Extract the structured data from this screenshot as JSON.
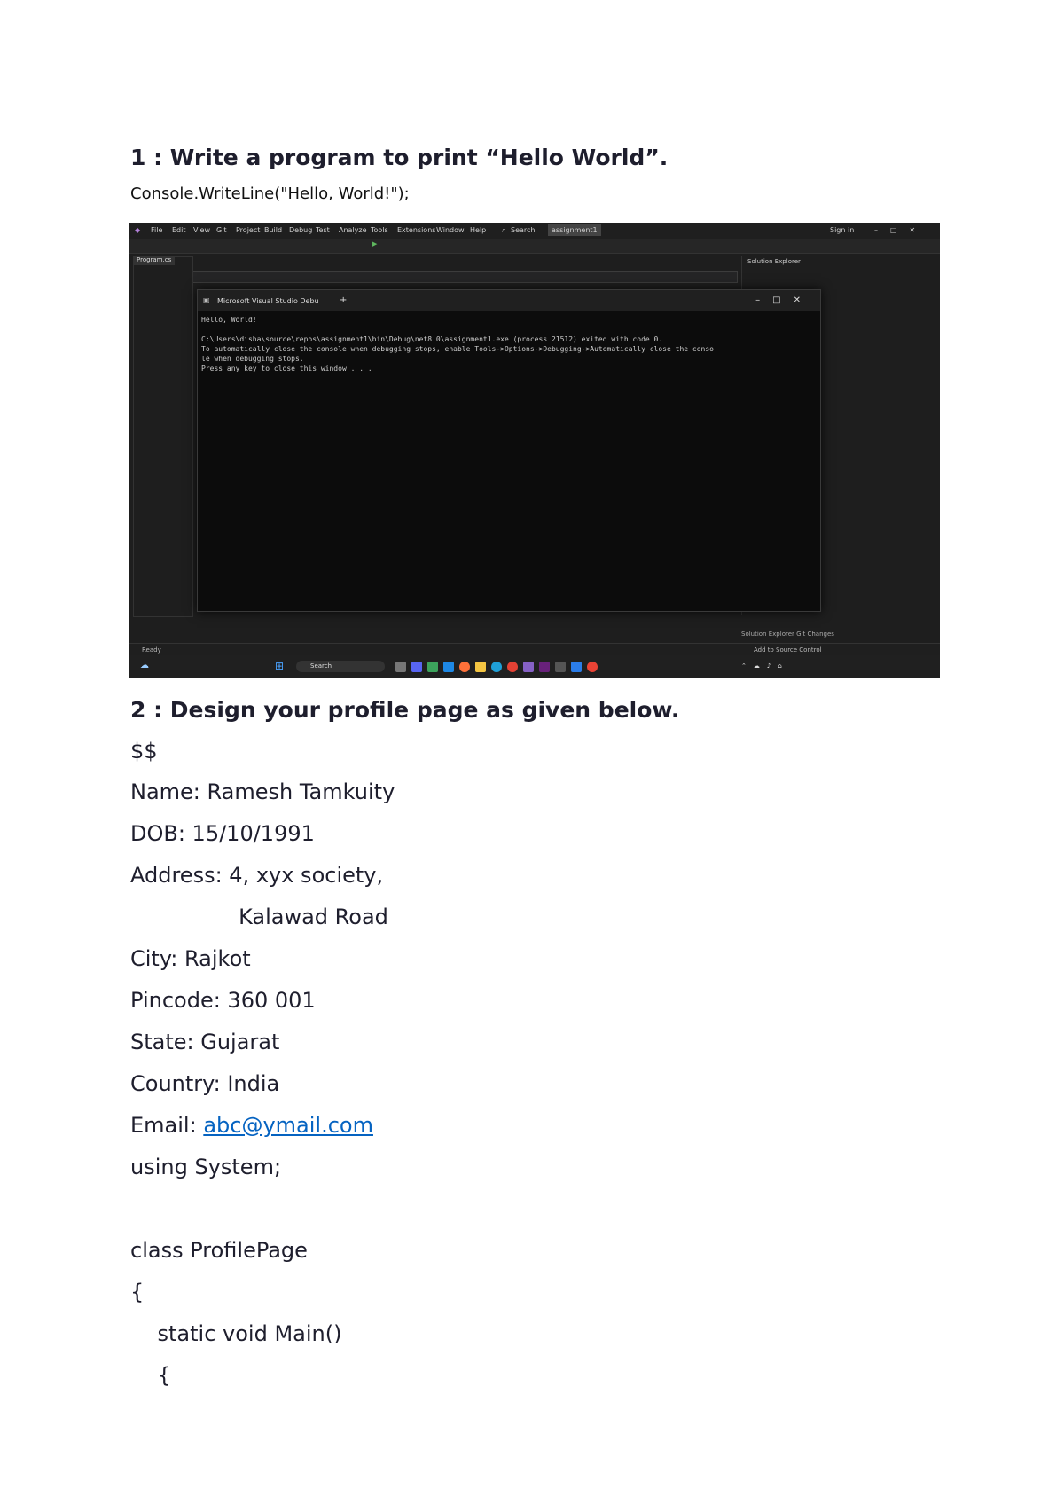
{
  "q1": {
    "heading": "1 : Write a program to print “Hello World”.",
    "code": "Console.WriteLine(\"Hello, World!\");"
  },
  "screenshot": {
    "menu": [
      "File",
      "Edit",
      "View",
      "Git",
      "Project",
      "Build",
      "Debug",
      "Test",
      "Analyze",
      "Tools",
      "Extensions",
      "Window",
      "Help",
      "Search",
      "assignment1"
    ],
    "sign_in": "Sign in",
    "left_tab": "Program.cs",
    "console_title": "Microsoft Visual Studio Debu",
    "console_output": "Hello, World!\n\nC:\\Users\\disha\\source\\repos\\assignment1\\bin\\Debug\\net8.0\\assignment1.exe (process 21512) exited with code 0.\nTo automatically close the console when debugging stops, enable Tools->Options->Debugging->Automatically close the conso\nle when debugging stops.\nPress any key to close this window . . .",
    "right_pane_title": "Solution Explorer",
    "status_left": "Ready",
    "status_right": "Add to Source Control",
    "solution_tabs": "Solution Explorer   Git Changes",
    "taskbar_search": "Search"
  },
  "q2": {
    "heading": "2 : Design your profile page as given below.",
    "lines": [
      "$$",
      "Name: Ramesh Tamkuity",
      "DOB: 15/10/1991",
      "Address: 4, xyx society,",
      "                Kalawad Road",
      "City: Rajkot",
      "Pincode: 360 001",
      "State: Gujarat",
      "Country: India"
    ],
    "email_label": "Email: ",
    "email_link": "abc@ymail.com",
    "code_lines": [
      "using System;",
      "",
      "class ProfilePage",
      "{",
      "    static void Main()",
      "    {"
    ]
  }
}
